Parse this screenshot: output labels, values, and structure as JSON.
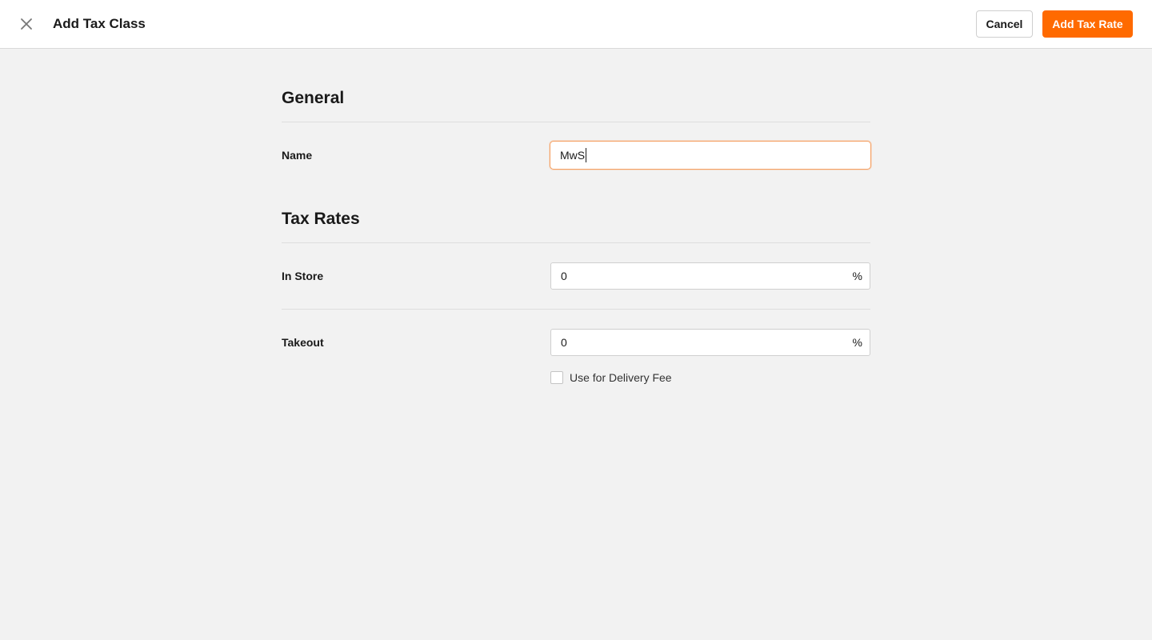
{
  "header": {
    "title": "Add Tax Class",
    "close_icon": "close-icon",
    "cancel_label": "Cancel",
    "primary_label": "Add Tax Rate"
  },
  "general": {
    "section_title": "General",
    "name_label": "Name",
    "name_value": "MwS"
  },
  "tax_rates": {
    "section_title": "Tax Rates",
    "in_store": {
      "label": "In Store",
      "value": "0",
      "unit": "%"
    },
    "takeout": {
      "label": "Takeout",
      "value": "0",
      "unit": "%"
    },
    "delivery_fee_checkbox": {
      "label": "Use for Delivery Fee",
      "checked": false
    }
  },
  "colors": {
    "accent": "#ff6a00",
    "background": "#f2f2f2",
    "focus_border": "#f5a063"
  }
}
